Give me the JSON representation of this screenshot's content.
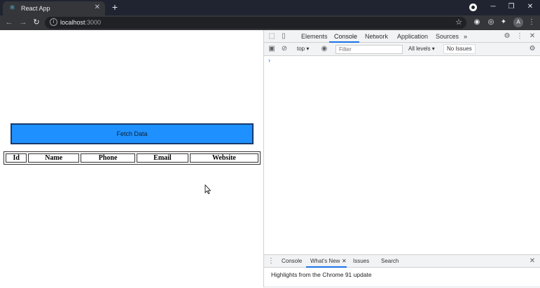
{
  "browser": {
    "tab_title": "React App",
    "tab_favicon": "react-icon",
    "tab_close": "✕",
    "new_tab": "+",
    "url_host": "localhost",
    "url_port": ":3000",
    "avatar_initial": "A"
  },
  "page": {
    "fetch_button_label": "Fetch Data",
    "fetch_button_color": "#1e90ff",
    "table_headers": [
      "Id",
      "Name",
      "Phone",
      "Email",
      "Website"
    ]
  },
  "devtools": {
    "tabs": [
      "Elements",
      "Console",
      "Network",
      "Application",
      "Sources"
    ],
    "active_tab": "Console",
    "more_tabs": "»",
    "context": "top",
    "filter_placeholder": "Filter",
    "levels": "All levels",
    "issues": "No Issues",
    "prompt": "›",
    "drawer_tabs": [
      "Console",
      "What's New",
      "Issues",
      "Search"
    ],
    "drawer_active_tab": "What's New",
    "drawer_text": "Highlights from the Chrome 91 update"
  }
}
